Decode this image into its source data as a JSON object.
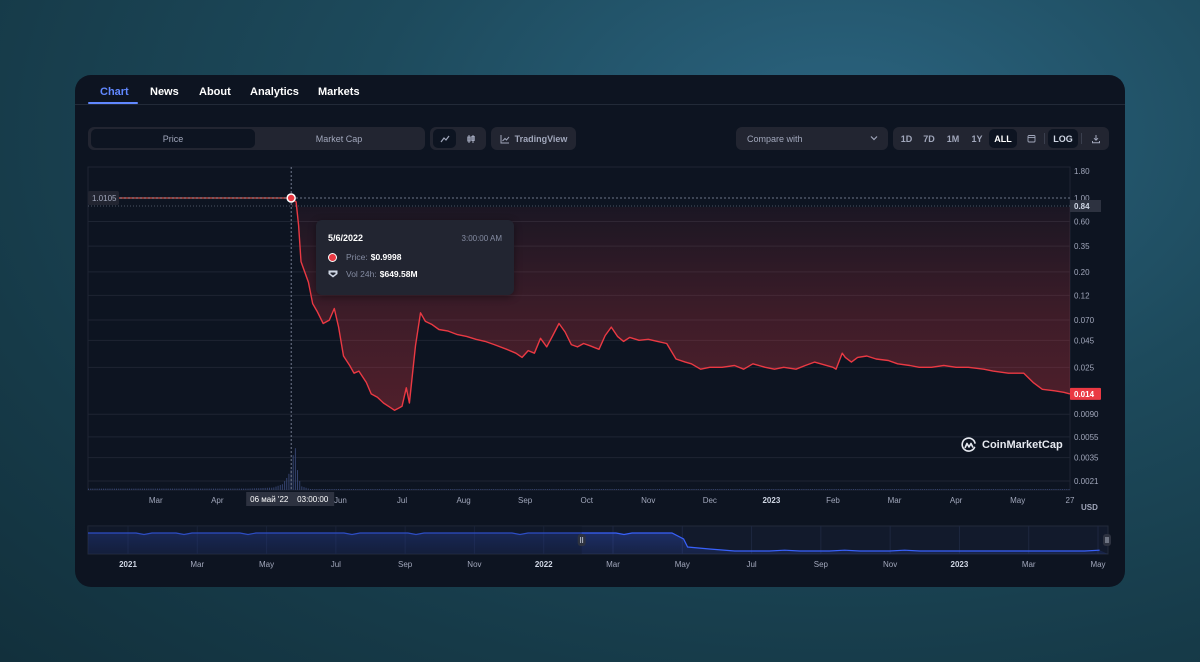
{
  "tabs": [
    {
      "label": "Chart",
      "active": true
    },
    {
      "label": "News",
      "active": false
    },
    {
      "label": "About",
      "active": false
    },
    {
      "label": "Analytics",
      "active": false
    },
    {
      "label": "Markets",
      "active": false
    }
  ],
  "toolbar": {
    "metric_toggle": [
      "Price",
      "Market Cap"
    ],
    "metric_selected": "Price",
    "chart_type_icons": [
      "line-chart-icon",
      "candlestick-icon"
    ],
    "tradingview_label": "TradingView",
    "compare_label": "Compare with",
    "ranges": [
      "1D",
      "7D",
      "1M",
      "1Y",
      "ALL"
    ],
    "range_selected": "ALL",
    "calendar_icon": "calendar-icon",
    "log_label": "LOG",
    "download_icon": "download-icon"
  },
  "tooltip": {
    "date": "5/6/2022",
    "time": "3:00:00 AM",
    "price_label": "Price:",
    "price_value": "$0.9998",
    "vol_label": "Vol 24h:",
    "vol_value": "$649.58M"
  },
  "crosshair": {
    "price_label": "1.0105",
    "time_label_date": "06 май '22",
    "time_label_time": "03:00:00"
  },
  "watermark": "CoinMarketCap",
  "currency": "USD",
  "colors": {
    "accent": "#6188ff",
    "price_line": "#ea3943",
    "card_bg": "#0d1421",
    "control_bg": "#222531",
    "navigator_line": "#3861fb"
  },
  "chart_data": {
    "type": "line",
    "title": "",
    "xlabel": "",
    "ylabel": "USD",
    "y_scale": "log",
    "ylim": [
      0.0021,
      1.8
    ],
    "grid": true,
    "legend": "none",
    "y_ticks": [
      "1.80",
      "1.00",
      "0.60",
      "0.35",
      "0.20",
      "0.12",
      "0.070",
      "0.045",
      "0.025",
      "0.0090",
      "0.0055",
      "0.0035",
      "0.0021"
    ],
    "y_tick_values": [
      1.8,
      1.0,
      0.6,
      0.35,
      0.2,
      0.12,
      0.07,
      0.045,
      0.025,
      0.009,
      0.0055,
      0.0035,
      0.0021
    ],
    "current_price_label": "0.014",
    "current_price": 0.014,
    "hover_marker_label": "0.84",
    "hover_marker_value": 0.84,
    "x_ticks": [
      {
        "label": "Mar",
        "m": 1.0,
        "bold": false
      },
      {
        "label": "Apr",
        "m": 2.0,
        "bold": false
      },
      {
        "label": "Jun",
        "m": 4.0,
        "bold": false
      },
      {
        "label": "Jul",
        "m": 5.0,
        "bold": false
      },
      {
        "label": "Aug",
        "m": 6.0,
        "bold": false
      },
      {
        "label": "Sep",
        "m": 7.0,
        "bold": false
      },
      {
        "label": "Oct",
        "m": 8.0,
        "bold": false
      },
      {
        "label": "Nov",
        "m": 9.0,
        "bold": false
      },
      {
        "label": "Dec",
        "m": 10.0,
        "bold": false
      },
      {
        "label": "2023",
        "m": 11.0,
        "bold": true
      },
      {
        "label": "Feb",
        "m": 12.0,
        "bold": false
      },
      {
        "label": "Mar",
        "m": 13.0,
        "bold": false
      },
      {
        "label": "Apr",
        "m": 14.0,
        "bold": false
      },
      {
        "label": "May",
        "m": 15.0,
        "bold": false
      },
      {
        "label": "27",
        "m": 15.85,
        "bold": false
      }
    ],
    "x_range_months": [
      -0.1,
      15.85
    ],
    "x_note": "m = months since 2022-02-01",
    "series": [
      {
        "name": "Price",
        "points": [
          [
            -0.1,
            1.0
          ],
          [
            1.0,
            1.0
          ],
          [
            2.0,
            1.0
          ],
          [
            3.15,
            1.0
          ],
          [
            3.2,
            0.9998
          ],
          [
            3.24,
            0.95
          ],
          [
            3.28,
            0.92
          ],
          [
            3.32,
            0.55
          ],
          [
            3.36,
            0.25
          ],
          [
            3.42,
            0.2
          ],
          [
            3.48,
            0.16
          ],
          [
            3.55,
            0.1
          ],
          [
            3.62,
            0.085
          ],
          [
            3.72,
            0.065
          ],
          [
            3.82,
            0.07
          ],
          [
            3.9,
            0.09
          ],
          [
            3.97,
            0.06
          ],
          [
            4.05,
            0.032
          ],
          [
            4.15,
            0.026
          ],
          [
            4.22,
            0.022
          ],
          [
            4.3,
            0.023
          ],
          [
            4.42,
            0.018
          ],
          [
            4.5,
            0.014
          ],
          [
            4.6,
            0.013
          ],
          [
            4.7,
            0.0115
          ],
          [
            4.8,
            0.0105
          ],
          [
            4.88,
            0.0098
          ],
          [
            4.95,
            0.0103
          ],
          [
            5.0,
            0.0107
          ],
          [
            5.07,
            0.016
          ],
          [
            5.12,
            0.0115
          ],
          [
            5.22,
            0.04
          ],
          [
            5.3,
            0.082
          ],
          [
            5.38,
            0.068
          ],
          [
            5.48,
            0.064
          ],
          [
            5.6,
            0.057
          ],
          [
            5.75,
            0.055
          ],
          [
            5.9,
            0.051
          ],
          [
            6.05,
            0.049
          ],
          [
            6.2,
            0.046
          ],
          [
            6.35,
            0.044
          ],
          [
            6.5,
            0.041
          ],
          [
            6.7,
            0.037
          ],
          [
            6.85,
            0.034
          ],
          [
            6.95,
            0.031
          ],
          [
            7.05,
            0.036
          ],
          [
            7.15,
            0.034
          ],
          [
            7.25,
            0.047
          ],
          [
            7.35,
            0.039
          ],
          [
            7.45,
            0.05
          ],
          [
            7.55,
            0.065
          ],
          [
            7.65,
            0.054
          ],
          [
            7.75,
            0.041
          ],
          [
            7.85,
            0.039
          ],
          [
            7.95,
            0.042
          ],
          [
            8.05,
            0.04
          ],
          [
            8.2,
            0.037
          ],
          [
            8.3,
            0.05
          ],
          [
            8.4,
            0.06
          ],
          [
            8.5,
            0.049
          ],
          [
            8.6,
            0.044
          ],
          [
            8.7,
            0.048
          ],
          [
            8.85,
            0.045
          ],
          [
            9.0,
            0.046
          ],
          [
            9.15,
            0.044
          ],
          [
            9.3,
            0.042
          ],
          [
            9.45,
            0.03
          ],
          [
            9.6,
            0.028
          ],
          [
            9.7,
            0.027
          ],
          [
            9.85,
            0.024
          ],
          [
            10.0,
            0.025
          ],
          [
            10.2,
            0.025
          ],
          [
            10.4,
            0.026
          ],
          [
            10.55,
            0.024
          ],
          [
            10.7,
            0.027
          ],
          [
            10.9,
            0.025
          ],
          [
            11.05,
            0.024
          ],
          [
            11.2,
            0.025
          ],
          [
            11.4,
            0.024
          ],
          [
            11.55,
            0.026
          ],
          [
            11.7,
            0.028
          ],
          [
            11.8,
            0.027
          ],
          [
            12.0,
            0.025
          ],
          [
            12.05,
            0.024
          ],
          [
            12.15,
            0.034
          ],
          [
            12.2,
            0.031
          ],
          [
            12.3,
            0.028
          ],
          [
            12.4,
            0.031
          ],
          [
            12.55,
            0.032
          ],
          [
            12.7,
            0.03
          ],
          [
            12.9,
            0.029
          ],
          [
            13.05,
            0.027
          ],
          [
            13.25,
            0.026
          ],
          [
            13.4,
            0.025
          ],
          [
            13.6,
            0.025
          ],
          [
            13.8,
            0.026
          ],
          [
            14.0,
            0.025
          ],
          [
            14.2,
            0.025
          ],
          [
            14.45,
            0.024
          ],
          [
            14.6,
            0.023
          ],
          [
            14.85,
            0.022
          ],
          [
            15.1,
            0.022
          ],
          [
            15.25,
            0.018
          ],
          [
            15.4,
            0.0155
          ],
          [
            15.6,
            0.015
          ],
          [
            15.75,
            0.0145
          ],
          [
            15.85,
            0.014
          ]
        ]
      },
      {
        "name": "Volume (relative)",
        "points": [
          [
            -0.1,
            0.03
          ],
          [
            2.5,
            0.03
          ],
          [
            2.9,
            0.05
          ],
          [
            3.05,
            0.12
          ],
          [
            3.12,
            0.25
          ],
          [
            3.2,
            0.45
          ],
          [
            3.25,
            1.0
          ],
          [
            3.3,
            0.35
          ],
          [
            3.35,
            0.08
          ],
          [
            3.5,
            0.02
          ],
          [
            5.0,
            0.015
          ],
          [
            15.85,
            0.01
          ]
        ]
      }
    ],
    "navigator": {
      "x_ticks": [
        "2021",
        "Mar",
        "May",
        "Jul",
        "Sep",
        "Nov",
        "2022",
        "Mar",
        "May",
        "Jul",
        "Sep",
        "Nov",
        "2023",
        "Mar",
        "May"
      ],
      "bold_ticks": [
        "2021",
        "2022",
        "2023"
      ],
      "selected_range_start_fraction": 0.484,
      "selected_range_end_fraction": 1.0
    }
  }
}
